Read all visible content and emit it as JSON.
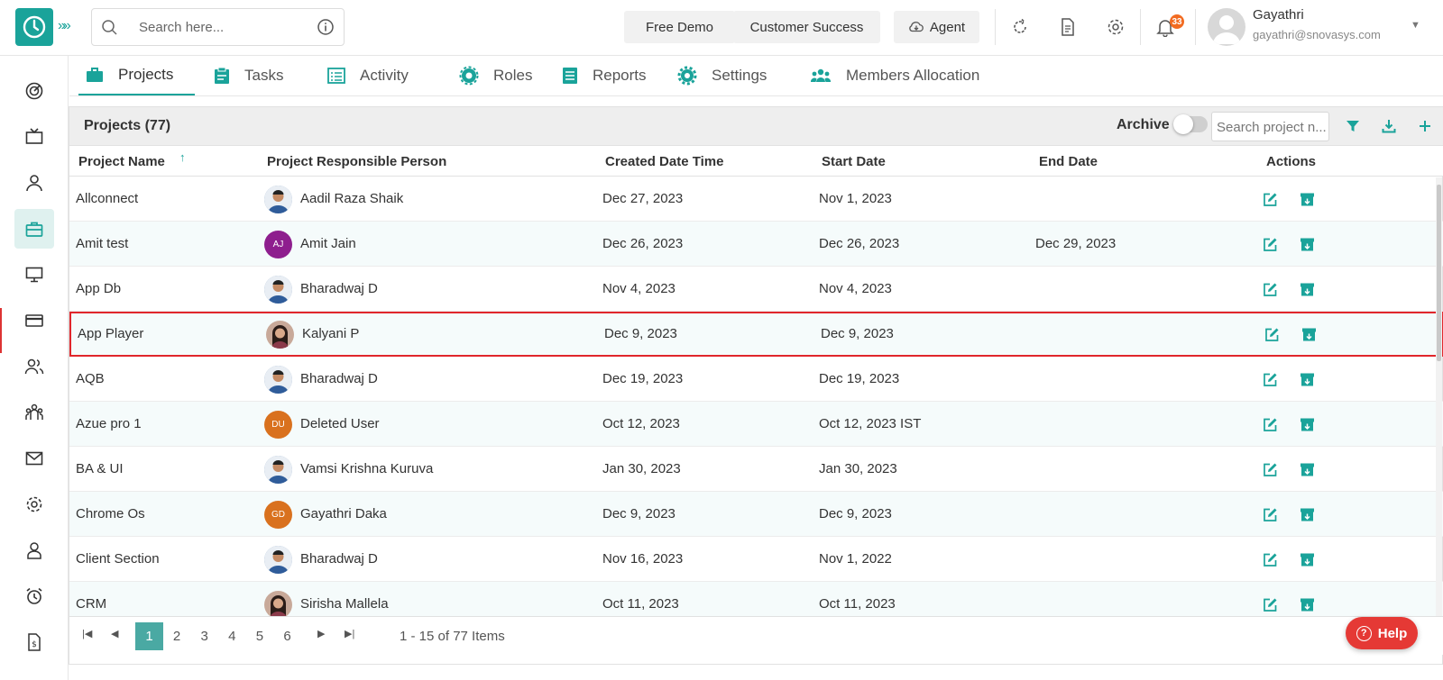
{
  "header": {
    "search_placeholder": "Search here...",
    "buttons": {
      "free_demo": "Free Demo",
      "customer_success": "Customer Success",
      "agent": "Agent"
    },
    "notifications_count": "33",
    "user": {
      "name": "Gayathri",
      "email": "gayathri@snovasys.com"
    }
  },
  "tabs": [
    {
      "label": "Projects",
      "icon": "briefcase-icon",
      "active": true
    },
    {
      "label": "Tasks",
      "icon": "clipboard-icon"
    },
    {
      "label": "Activity",
      "icon": "list-icon"
    },
    {
      "label": "Roles",
      "icon": "gear-badge-icon"
    },
    {
      "label": "Reports",
      "icon": "report-icon"
    },
    {
      "label": "Settings",
      "icon": "gear-icon"
    },
    {
      "label": "Members Allocation",
      "icon": "group-icon"
    }
  ],
  "panel": {
    "title": "Projects (77)",
    "archive_label": "Archive",
    "search_placeholder": "Search project n..."
  },
  "table": {
    "columns": [
      "Project Name",
      "Project Responsible Person",
      "Created Date Time",
      "Start Date",
      "End Date",
      "Actions"
    ],
    "rows": [
      {
        "name": "Allconnect",
        "person": "Aadil Raza Shaik",
        "initials": "",
        "avatar": "photo",
        "created": "Dec 27, 2023",
        "start": "Nov 1, 2023",
        "end": ""
      },
      {
        "name": "Amit test",
        "person": "Amit Jain",
        "initials": "AJ",
        "avatar": "initials-purple",
        "created": "Dec 26, 2023",
        "start": "Dec 26, 2023",
        "end": "Dec 29, 2023"
      },
      {
        "name": "App Db",
        "person": "Bharadwaj D",
        "initials": "",
        "avatar": "photo",
        "created": "Nov 4, 2023",
        "start": "Nov 4, 2023",
        "end": ""
      },
      {
        "name": "App Player",
        "person": "Kalyani P",
        "initials": "",
        "avatar": "photo-female",
        "created": "Dec 9, 2023",
        "start": "Dec 9, 2023",
        "end": "",
        "highlighted": true
      },
      {
        "name": "AQB",
        "person": "Bharadwaj D",
        "initials": "",
        "avatar": "photo",
        "created": "Dec 19, 2023",
        "start": "Dec 19, 2023",
        "end": ""
      },
      {
        "name": "Azue pro 1",
        "person": "Deleted User",
        "initials": "DU",
        "avatar": "initials-orange",
        "created": "Oct 12, 2023",
        "start": "Oct 12, 2023 IST",
        "end": ""
      },
      {
        "name": "BA & UI",
        "person": "Vamsi Krishna Kuruva",
        "initials": "",
        "avatar": "photo",
        "created": "Jan 30, 2023",
        "start": "Jan 30, 2023",
        "end": ""
      },
      {
        "name": "Chrome Os",
        "person": "Gayathri Daka",
        "initials": "GD",
        "avatar": "initials-orange",
        "created": "Dec 9, 2023",
        "start": "Dec 9, 2023",
        "end": ""
      },
      {
        "name": "Client Section",
        "person": "Bharadwaj D",
        "initials": "",
        "avatar": "photo",
        "created": "Nov 16, 2023",
        "start": "Nov 1, 2022",
        "end": ""
      },
      {
        "name": "CRM",
        "person": "Sirisha Mallela",
        "initials": "",
        "avatar": "photo-female",
        "created": "Oct 11, 2023",
        "start": "Oct 11, 2023",
        "end": ""
      }
    ]
  },
  "pagination": {
    "pages": [
      "1",
      "2",
      "3",
      "4",
      "5",
      "6"
    ],
    "active_page": "1",
    "info": "1 - 15 of 77 Items"
  },
  "help_label": "Help",
  "colors": {
    "accent": "#1aa39a",
    "highlight_border": "#e0262b",
    "help": "#e53935",
    "badge": "#f26b21"
  }
}
